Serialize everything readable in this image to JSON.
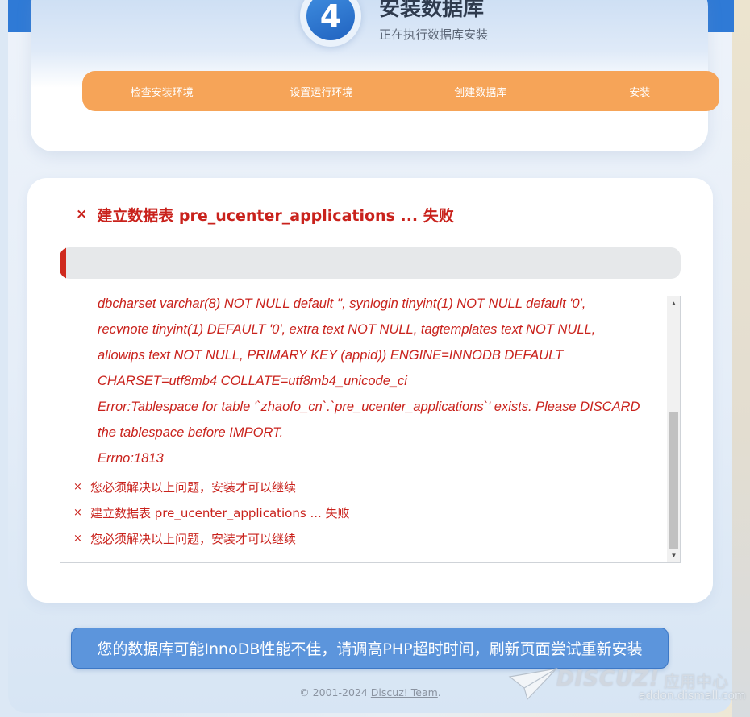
{
  "header": {
    "step_number": "4",
    "title": "安装数据库",
    "subtitle": "正在执行数据库安装",
    "steps": [
      "检查安装环境",
      "设置运行环境",
      "创建数据库",
      "安装"
    ]
  },
  "status": {
    "icon": "close-icon",
    "text": "建立数据表 pre_ucenter_applications ... 失败",
    "color": "#c9221c"
  },
  "install_progress": {
    "fraction": 0.01,
    "color": "#cf2a1e"
  },
  "log": {
    "lines": [
      "dbcharset varchar(8) NOT NULL default '', synlogin tinyint(1) NOT NULL default '0',",
      "recvnote tinyint(1) DEFAULT '0', extra text NOT NULL, tagtemplates text NOT NULL,",
      "allowips text NOT NULL, PRIMARY KEY (appid)) ENGINE=INNODB DEFAULT",
      "CHARSET=utf8mb4 COLLATE=utf8mb4_unicode_ci",
      "Error:Tablespace for table '`zhaofo_cn`.`pre_ucenter_applications`' exists. Please DISCARD",
      "the tablespace before IMPORT.",
      "Errno:1813"
    ],
    "messages": [
      "您必须解决以上问题，安装才可以继续",
      "建立数据表 pre_ucenter_applications ... 失败",
      "您必须解决以上问题，安装才可以继续"
    ],
    "message_icon": "close-icon"
  },
  "notice": {
    "text": "您的数据库可能InnoDB性能不佳，请调高PHP超时时间，刷新页面尝试重新安装",
    "color": "#5c95dc"
  },
  "footer": {
    "copyright": "© 2001-2024",
    "link": "Discuz! Team",
    "suffix": "."
  },
  "watermark": {
    "brand": "DISCUZ!",
    "center": "应用中心",
    "url": "addon.dismall.com"
  },
  "colors": {
    "accent_orange": "#f6a458",
    "brand_blue": "#2f7ad6",
    "error_red": "#c9221c"
  }
}
